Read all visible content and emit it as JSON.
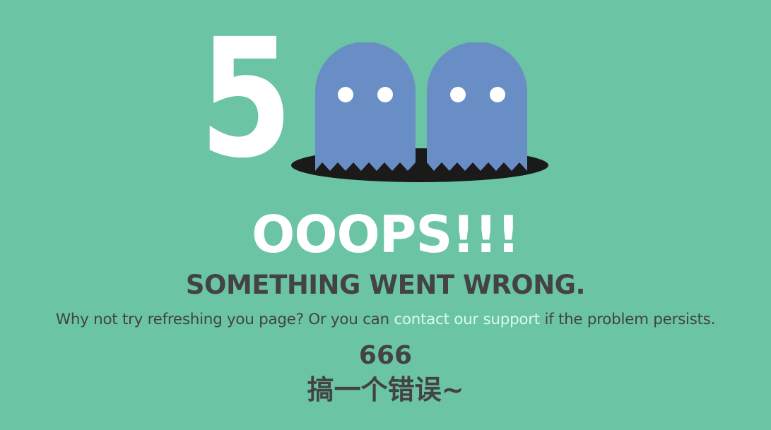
{
  "error": {
    "digit": "5",
    "ghost_icons": [
      "ghost-icon",
      "ghost-icon"
    ],
    "title": "OOOPS!!!",
    "subtitle": "SOMETHING WENT WRONG.",
    "message_before": "Why not try refreshing you page? Or you can ",
    "support_link": "contact our support",
    "message_after": " if the problem persists.",
    "code": "666",
    "note": "搞一个错误~"
  },
  "colors": {
    "background": "#6bc4a4",
    "ghost": "#698ec5",
    "hole": "#1a1a1a",
    "text": "#434343",
    "link": "#d7fde4",
    "white": "#ffffff"
  }
}
